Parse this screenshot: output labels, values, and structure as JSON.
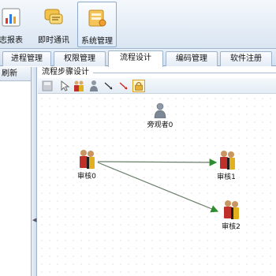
{
  "ribbon": {
    "buttons": [
      {
        "label": "志报表",
        "icon": "report-chart-icon",
        "active": false
      },
      {
        "label": "即时通讯",
        "icon": "instant-message-icon",
        "active": false
      },
      {
        "label": "系统管理",
        "icon": "system-management-icon",
        "active": true
      }
    ]
  },
  "tabs": [
    {
      "label": "进程管理",
      "active": false
    },
    {
      "label": "权限管理",
      "active": false
    },
    {
      "label": "流程设计",
      "active": true
    },
    {
      "label": "编码管理",
      "active": false
    },
    {
      "label": "软件注册",
      "active": false
    }
  ],
  "left_panel": {
    "header": "刷新"
  },
  "designer": {
    "title": "流程步骤设计",
    "toolbar": [
      {
        "icon": "save-icon"
      },
      {
        "icon": "pointer-icon"
      },
      {
        "icon": "add-approver-icon"
      },
      {
        "icon": "add-observer-icon"
      },
      {
        "icon": "connector-line-icon"
      },
      {
        "icon": "connector-line-red-icon"
      },
      {
        "icon": "lock-icon",
        "active": true
      }
    ],
    "nodes": [
      {
        "label": "旁观者0",
        "type": "observer"
      },
      {
        "label": "审核0",
        "type": "approver"
      },
      {
        "label": "审核1",
        "type": "approver"
      },
      {
        "label": "审核2",
        "type": "approver"
      }
    ],
    "edges": [
      {
        "from": "审核0",
        "to": "审核1"
      },
      {
        "from": "审核0",
        "to": "审核2"
      }
    ]
  },
  "colors": {
    "accent": "#2e8b2e",
    "ribbon_bg": "#d9e5f2",
    "border": "#9fb3cb"
  }
}
